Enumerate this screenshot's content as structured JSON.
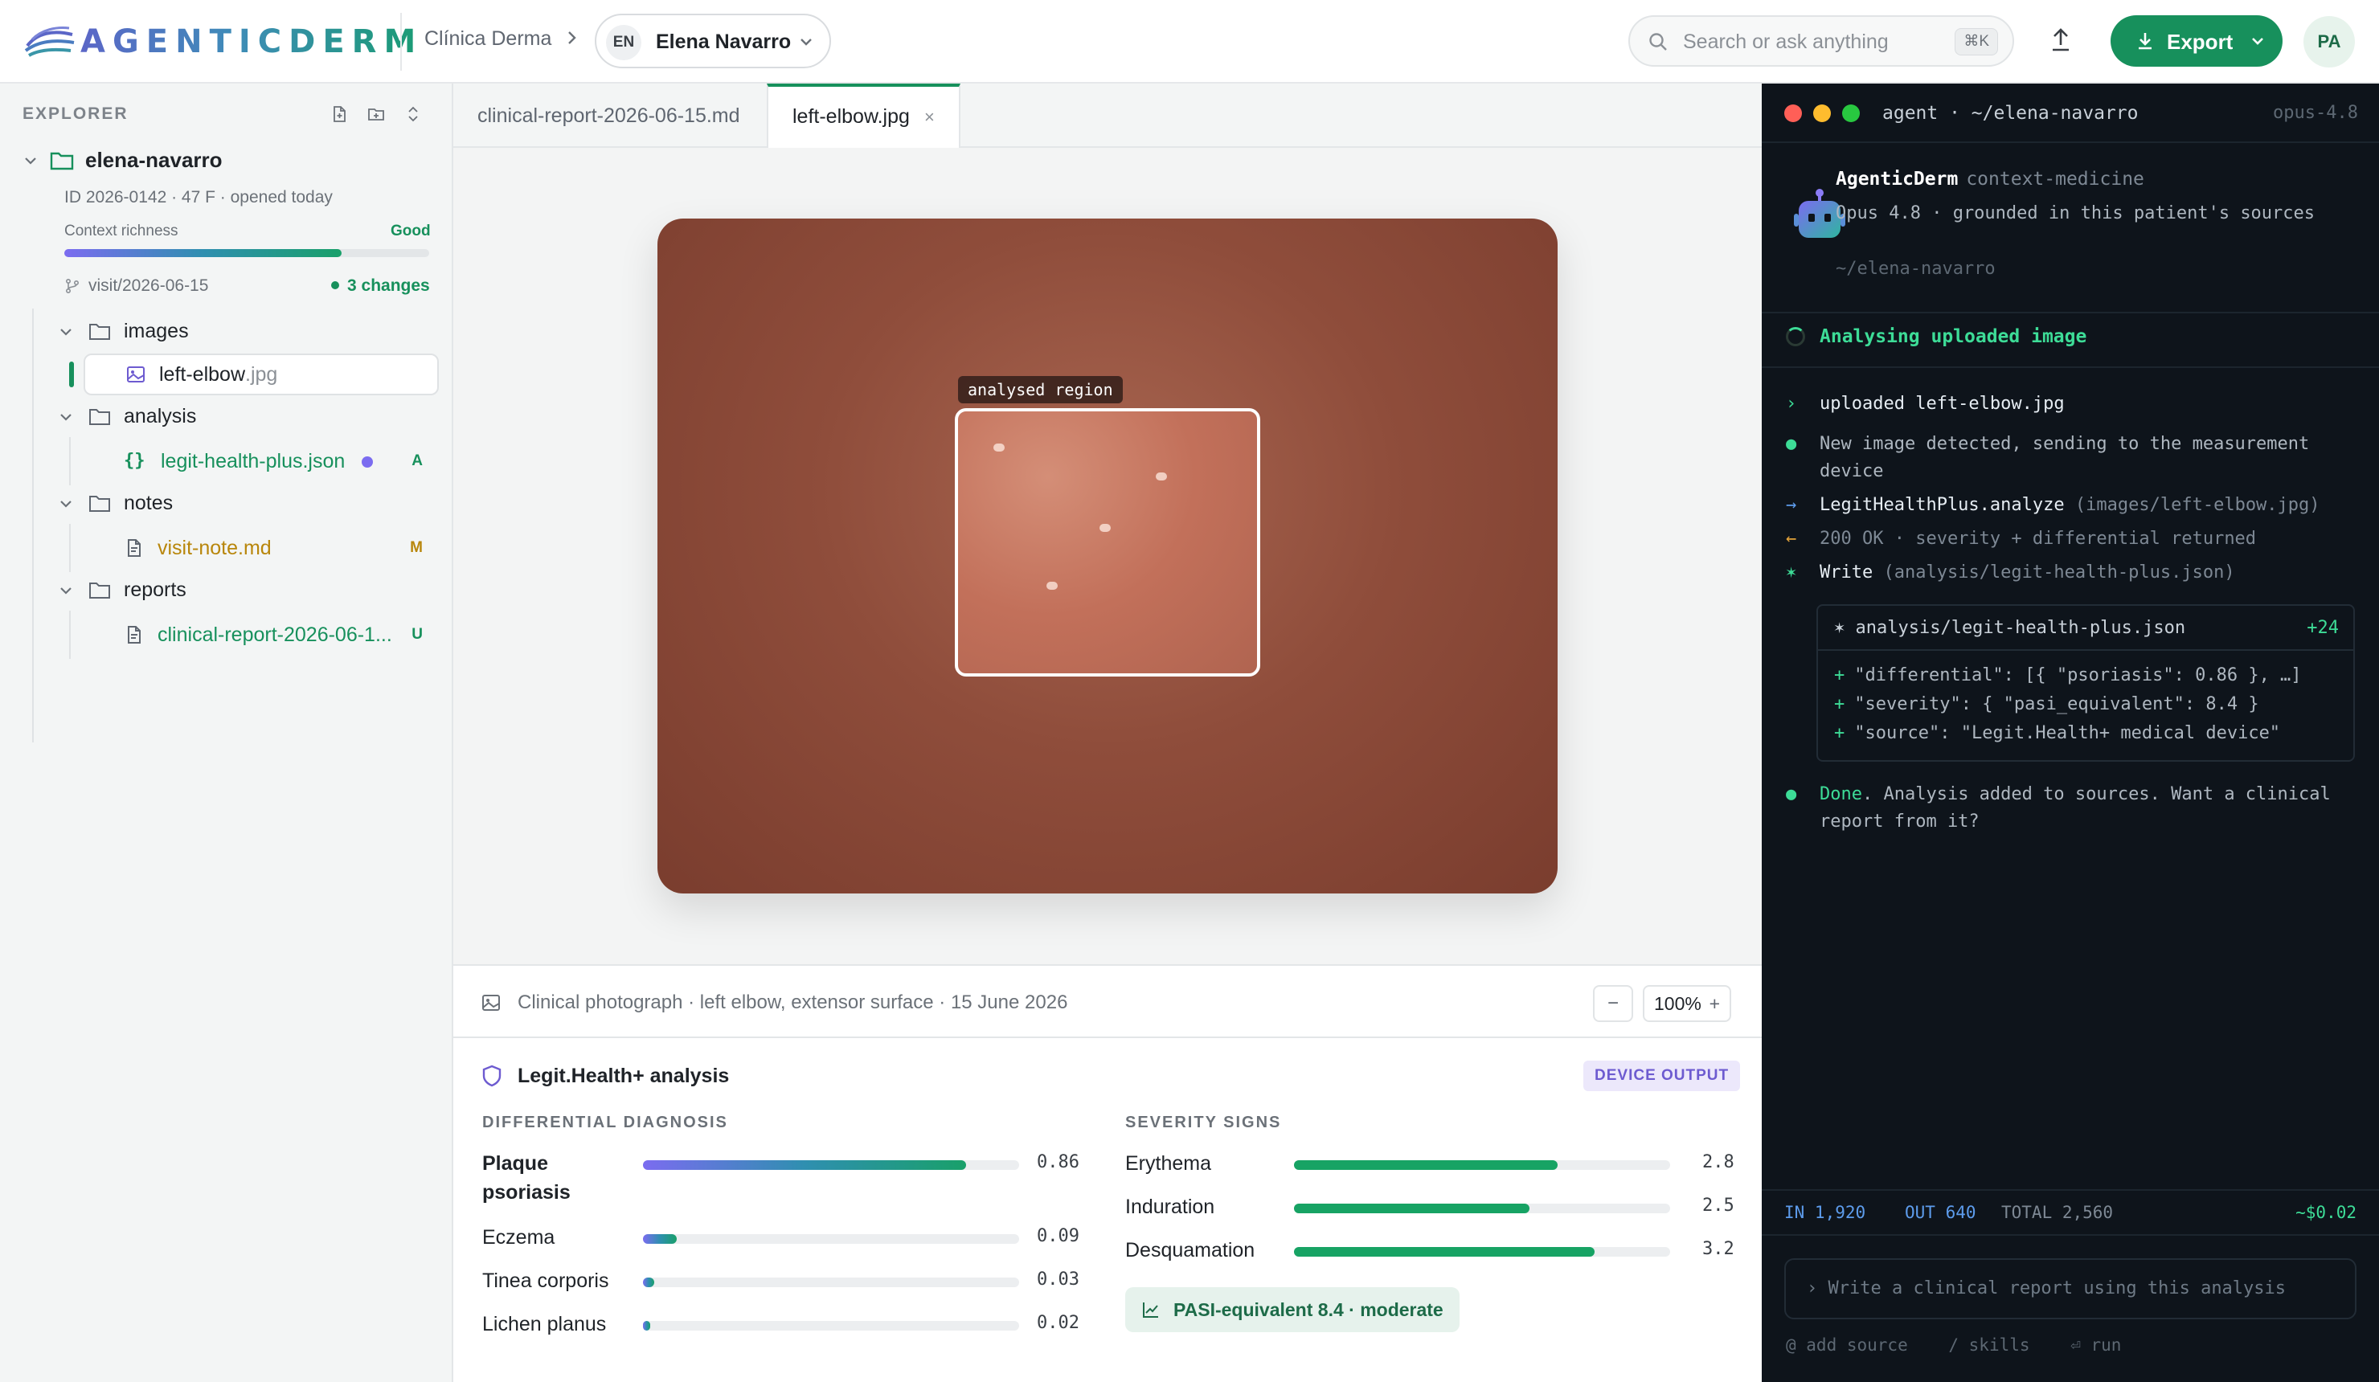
{
  "topbar": {
    "logo_text": "AGENTICDERM",
    "clinic": "Clínica Derma",
    "patient_initials": "EN",
    "patient_name": "Elena Navarro",
    "search_placeholder": "Search or ask anything",
    "search_shortcut": "⌘K",
    "export_label": "Export",
    "user_initials": "PA"
  },
  "explorer": {
    "title": "EXPLORER",
    "root_name": "elena-navarro",
    "meta": "ID 2026-0142 · 47 F · opened today",
    "context_label": "Context richness",
    "context_value": "Good",
    "context_fraction": 0.76,
    "branch": "visit/2026-06-15",
    "changes": "3 changes",
    "folders": [
      {
        "name": "images",
        "files": [
          {
            "name": "left-elbow",
            "ext": ".jpg",
            "badge": "",
            "active": true
          }
        ]
      },
      {
        "name": "analysis",
        "files": [
          {
            "name": "legit-health-plus.json",
            "ext": "",
            "badge": "A"
          }
        ]
      },
      {
        "name": "notes",
        "files": [
          {
            "name": "visit-note.md",
            "ext": "",
            "badge": "M"
          }
        ]
      },
      {
        "name": "reports",
        "files": [
          {
            "name": "clinical-report-2026-06-1...",
            "ext": "",
            "badge": "U"
          }
        ]
      }
    ]
  },
  "tabs": [
    {
      "label": "clinical-report-2026-06-15.md"
    },
    {
      "label": "left-elbow.jpg",
      "close": "×"
    }
  ],
  "viewer": {
    "region_label": "analysed region",
    "caption": "Clinical photograph · left elbow, extensor surface · 15 June 2026",
    "zoom_minus": "−",
    "zoom": "100%",
    "zoom_plus": "+"
  },
  "analysis": {
    "title": "Legit.Health+ analysis",
    "badge": "DEVICE OUTPUT",
    "differential_heading": "DIFFERENTIAL DIAGNOSIS",
    "differential": [
      {
        "name": "Plaque psoriasis",
        "value": "0.86",
        "fraction": 0.86
      },
      {
        "name": "Eczema",
        "value": "0.09",
        "fraction": 0.09
      },
      {
        "name": "Tinea corporis",
        "value": "0.03",
        "fraction": 0.03
      },
      {
        "name": "Lichen planus",
        "value": "0.02",
        "fraction": 0.02
      }
    ],
    "severity_heading": "SEVERITY SIGNS",
    "severity": [
      {
        "name": "Erythema",
        "value": "2.8",
        "fraction": 0.7
      },
      {
        "name": "Induration",
        "value": "2.5",
        "fraction": 0.625
      },
      {
        "name": "Desquamation",
        "value": "3.2",
        "fraction": 0.8
      }
    ],
    "pasi": "PASI-equivalent 8.4 · moderate"
  },
  "agent": {
    "path": "agent · ~/elena-navarro",
    "model": "opus-4.8",
    "name": "AgenticDerm",
    "mode": "context-medicine",
    "desc": "Opus 4.8 · grounded in this patient's sources",
    "sub": "~/elena-navarro",
    "status": "Analysing uploaded image",
    "log": [
      {
        "sym": "›",
        "text": "uploaded left-elbow.jpg"
      },
      {
        "sym": "●",
        "text": "New image detected, sending to the measurement device"
      },
      {
        "sym": "→",
        "main": "LegitHealthPlus.analyze",
        "arg": "(images/left-elbow.jpg)"
      },
      {
        "sym": "←",
        "text": "200 OK · severity + differential returned"
      },
      {
        "sym": "✶",
        "main": "Write",
        "arg": "(analysis/legit-health-plus.json)"
      }
    ],
    "diff": {
      "file": "✶ analysis/legit-health-plus.json",
      "count": "+24",
      "lines": [
        "\"differential\": [{ \"psoriasis\": 0.86 }, …]",
        "\"severity\": { \"pasi_equivalent\": 8.4 }",
        "\"source\": \"Legit.Health+ medical device\""
      ]
    },
    "done_bold": "Done",
    "done_text": ". Analysis added to sources. Want a clinical report from it?",
    "usage": {
      "in": "IN 1,920",
      "out": "OUT 640",
      "total": "TOTAL 2,560",
      "cost": "~$0.02"
    },
    "prompt": "› Write a clinical report using this analysis",
    "hints": [
      "@ add source",
      "/ skills",
      "⏎ run"
    ]
  }
}
